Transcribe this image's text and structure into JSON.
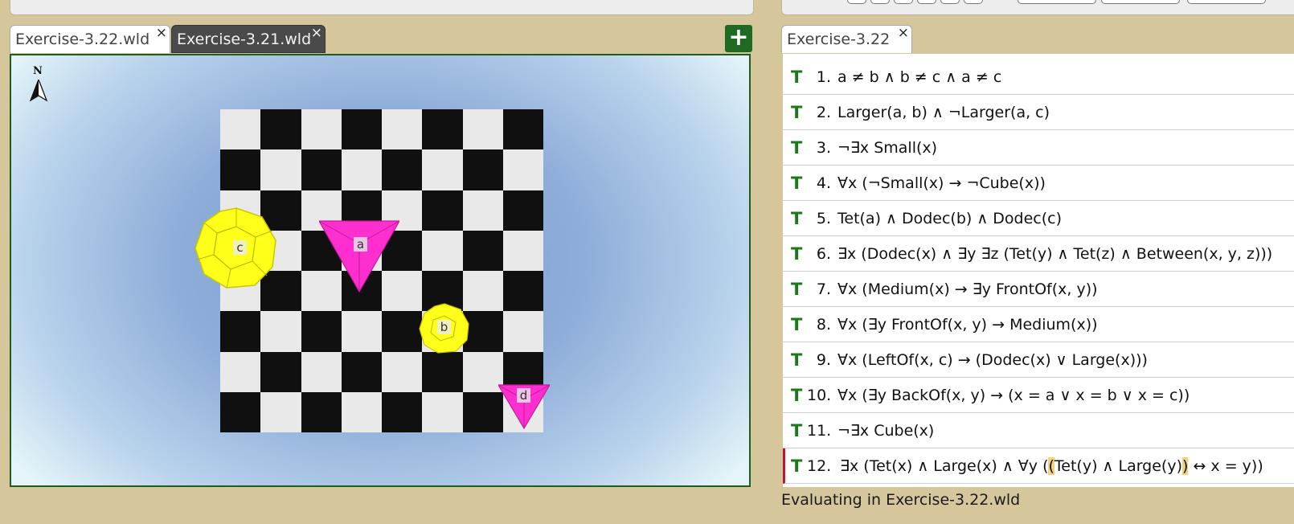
{
  "world_tabs": [
    {
      "label": "Exercise-3.22.wld",
      "active": true
    },
    {
      "label": "Exercise-3.21.wld",
      "active": false
    }
  ],
  "add_tab_label": "+",
  "close_glyph": "×",
  "compass_label": "N",
  "board": {
    "rows": 8,
    "cols": 8
  },
  "world_objects": [
    {
      "name": "a",
      "shape": "tet",
      "size": "large",
      "color": "#ff33cc"
    },
    {
      "name": "b",
      "shape": "dodec",
      "size": "medium",
      "color": "#ffff00"
    },
    {
      "name": "c",
      "shape": "dodec",
      "size": "large",
      "color": "#ffff00"
    },
    {
      "name": "d",
      "shape": "tet",
      "size": "medium",
      "color": "#ff33cc"
    }
  ],
  "sentence_tab": {
    "label": "Exercise-3.22"
  },
  "sentences": [
    {
      "tv": "T",
      "num": "1.",
      "text": "a ≠ b ∧ b ≠ c ∧ a ≠ c"
    },
    {
      "tv": "T",
      "num": "2.",
      "text": "Larger(a, b) ∧ ¬Larger(a, c)"
    },
    {
      "tv": "T",
      "num": "3.",
      "text": "¬∃x Small(x)"
    },
    {
      "tv": "T",
      "num": "4.",
      "text": "∀x (¬Small(x) → ¬Cube(x))"
    },
    {
      "tv": "T",
      "num": "5.",
      "text": "Tet(a) ∧ Dodec(b) ∧ Dodec(c)"
    },
    {
      "tv": "T",
      "num": "6.",
      "text": "∃x (Dodec(x) ∧ ∃y ∃z (Tet(y) ∧ Tet(z) ∧ Between(x, y, z)))"
    },
    {
      "tv": "T",
      "num": "7.",
      "text": "∀x (Medium(x) → ∃y FrontOf(x, y))"
    },
    {
      "tv": "T",
      "num": "8.",
      "text": "∀x (∃y FrontOf(x, y) → Medium(x))"
    },
    {
      "tv": "T",
      "num": "9.",
      "text": "∀x (LeftOf(x, c) → (Dodec(x) ∨ Large(x)))"
    },
    {
      "tv": "T",
      "num": "10.",
      "text": "∀x (∃y BackOf(x, y) → (x = a ∨ x = b ∨ x = c))"
    },
    {
      "tv": "T",
      "num": "11.",
      "text": "¬∃x Cube(x)"
    },
    {
      "tv": "T",
      "num": "12.",
      "text_pre": "∃x (Tet(x) ∧ Large(x) ∧ ∀y (",
      "text_hl1": "(",
      "text_mid": "Tet(y) ∧ Large(y)",
      "text_hl2": ")",
      "text_post": " ↔ x = y))",
      "selected": true
    }
  ],
  "status_text": "Evaluating in Exercise-3.22.wld",
  "colors": {
    "true_value": "#1a7a1a",
    "selection_bar": "#c0152f",
    "paren_highlight": "#f3d27e",
    "add_button": "#1f6a23"
  }
}
